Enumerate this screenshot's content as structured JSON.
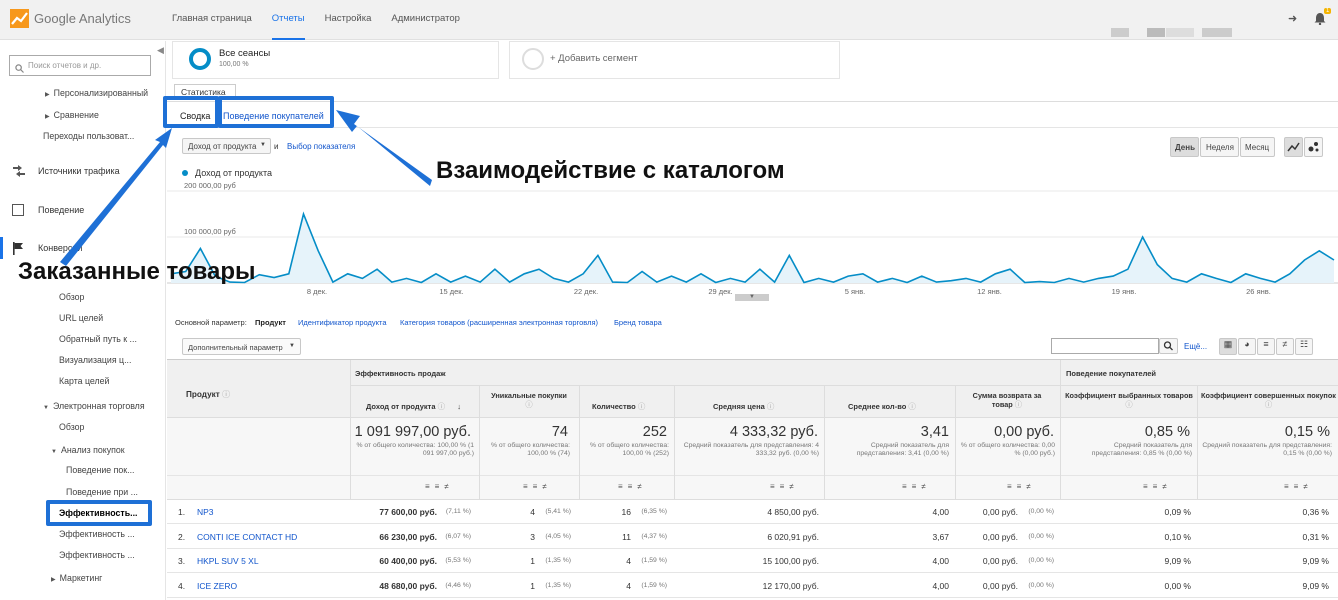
{
  "app": {
    "name": "Google Analytics"
  },
  "topnav": [
    {
      "label": "Главная страница",
      "active": false
    },
    {
      "label": "Отчеты",
      "active": true
    },
    {
      "label": "Настройка",
      "active": false
    },
    {
      "label": "Администратор",
      "active": false
    }
  ],
  "notifications_badge": "1",
  "sidebar": {
    "search_placeholder": "Поиск отчетов и др.",
    "items": [
      {
        "label": "Персонализированный",
        "caret": true
      },
      {
        "label": "Сравнение",
        "caret": true
      },
      {
        "label": "Переходы пользоват..."
      },
      {
        "label": "Источники трафика",
        "section": true
      },
      {
        "label": "Поведение",
        "section": true
      },
      {
        "label": "Конверсии",
        "section": true
      },
      {
        "label": "Обзор"
      },
      {
        "label": "URL целей"
      },
      {
        "label": "Обратный путь к ..."
      },
      {
        "label": "Визуализация ц..."
      },
      {
        "label": "Карта целей"
      },
      {
        "label": "Электронная торговля",
        "caret": true
      },
      {
        "label": "Обзор"
      },
      {
        "label": "Анализ покупок",
        "caret": true
      },
      {
        "label": "Поведение пок..."
      },
      {
        "label": "Поведение при ..."
      },
      {
        "label": "Эффективность...",
        "selected": true
      },
      {
        "label": "Эффективность ..."
      },
      {
        "label": "Эффективность ..."
      },
      {
        "label": "Маркетинг",
        "caret": true
      }
    ]
  },
  "segments": {
    "all_sessions": "Все сеансы",
    "all_sessions_pct": "100,00 %",
    "add_segment": "+ Добавить сегмент"
  },
  "tabs": {
    "stats": "Статистика",
    "summary": "Сводка",
    "behavior": "Поведение покупателей"
  },
  "chart_controls": {
    "metric_select": "Доход от продукта",
    "and": "и",
    "choose_metric": "Выбор показателя",
    "day": "День",
    "week": "Неделя",
    "month": "Месяц"
  },
  "chart_data": {
    "type": "area",
    "legend": "Доход от продукта",
    "ylim": [
      0,
      200000
    ],
    "yticks": [
      "200 000,00 руб",
      "100 000,00 руб"
    ],
    "xticks": [
      "8 дек.",
      "15 дек.",
      "22 дек.",
      "29 дек.",
      "5 янв.",
      "12 янв.",
      "19 янв.",
      "26 янв."
    ],
    "color": "#058dc7",
    "series": [
      {
        "values": [
          20000,
          25000,
          75000,
          15000,
          2000,
          1000,
          18000,
          12000,
          20000,
          150000,
          70000,
          2000,
          20000,
          10000,
          30000,
          2000,
          10000,
          1000,
          20000,
          2000,
          15000,
          2000,
          30000,
          2000,
          20000,
          30000,
          10000,
          2000,
          20000,
          60000,
          2000,
          1000,
          25000,
          2000,
          15000,
          2000,
          20000,
          1000,
          10000,
          2000,
          30000,
          2000,
          60000,
          1000,
          10000,
          2000,
          15000,
          20000,
          2000,
          10000,
          1000,
          15000,
          2000,
          5000,
          10000,
          2000,
          20000,
          30000,
          1000,
          3000,
          1000,
          10000,
          2000,
          10000,
          15000,
          30000,
          100000,
          40000,
          10000,
          2000,
          20000,
          10000,
          1000,
          20000,
          10000,
          2000,
          20000,
          50000,
          70000,
          50000
        ]
      }
    ]
  },
  "dimensions": {
    "label": "Основной параметр:",
    "active": "Продукт",
    "items": [
      "Идентификатор продукта",
      "Категория товаров (расширенная электронная торговля)",
      "Бренд товара"
    ],
    "secondary": "Дополнительный параметр",
    "more": "Ещё..."
  },
  "table": {
    "group_sales": "Эффективность продаж",
    "group_behavior": "Поведение покупателей",
    "col_product": "Продукт",
    "columns": [
      "Доход от продукта",
      "Уникальные покупки",
      "Количество",
      "Средняя цена",
      "Среднее кол-во",
      "Сумма возврата за товар",
      "Коэффициент выбранных товаров",
      "Коэффициент совершенных покупок"
    ],
    "totals": [
      {
        "value": "1 091 997,00 руб.",
        "note": "% от общего количества: 100,00 % (1 091 997,00 руб.)"
      },
      {
        "value": "74",
        "note": "% от общего количества: 100,00 % (74)"
      },
      {
        "value": "252",
        "note": "% от общего количества: 100,00 % (252)"
      },
      {
        "value": "4 333,32 руб.",
        "note": "Средний показатель для представления: 4 333,32 руб. (0,00 %)"
      },
      {
        "value": "3,41",
        "note": "Средний показатель для представления: 3,41 (0,00 %)"
      },
      {
        "value": "0,00 руб.",
        "note": "% от общего количества: 0,00 % (0,00 руб.)"
      },
      {
        "value": "0,85 %",
        "note": "Средний показатель для представления: 0,85 % (0,00 %)"
      },
      {
        "value": "0,15 %",
        "note": "Средний показатель для представления: 0,15 % (0,00 %)"
      }
    ],
    "rows": [
      {
        "n": "1.",
        "product": "NP3",
        "revenue": "77 600,00 руб.",
        "revenue_pct": "(7,11 %)",
        "unique": "4",
        "unique_pct": "(5,41 %)",
        "qty": "16",
        "qty_pct": "(6,35 %)",
        "avg_price": "4 850,00 руб.",
        "avg_qty": "4,00",
        "refund": "0,00 руб.",
        "refund_pct": "(0,00 %)",
        "cart_rate": "0,09 %",
        "buy_rate": "0,36 %"
      },
      {
        "n": "2.",
        "product": "CONTI ICE CONTACT HD",
        "revenue": "66 230,00 руб.",
        "revenue_pct": "(6,07 %)",
        "unique": "3",
        "unique_pct": "(4,05 %)",
        "qty": "11",
        "qty_pct": "(4,37 %)",
        "avg_price": "6 020,91 руб.",
        "avg_qty": "3,67",
        "refund": "0,00 руб.",
        "refund_pct": "(0,00 %)",
        "cart_rate": "0,10 %",
        "buy_rate": "0,31 %"
      },
      {
        "n": "3.",
        "product": "HKPL SUV 5 XL",
        "revenue": "60 400,00 руб.",
        "revenue_pct": "(5,53 %)",
        "unique": "1",
        "unique_pct": "(1,35 %)",
        "qty": "4",
        "qty_pct": "(1,59 %)",
        "avg_price": "15 100,00 руб.",
        "avg_qty": "4,00",
        "refund": "0,00 руб.",
        "refund_pct": "(0,00 %)",
        "cart_rate": "9,09 %",
        "buy_rate": "9,09 %"
      },
      {
        "n": "4.",
        "product": "ICE ZERO",
        "revenue": "48 680,00 руб.",
        "revenue_pct": "(4,46 %)",
        "unique": "1",
        "unique_pct": "(1,35 %)",
        "qty": "4",
        "qty_pct": "(1,59 %)",
        "avg_price": "12 170,00 руб.",
        "avg_qty": "4,00",
        "refund": "0,00 руб.",
        "refund_pct": "(0,00 %)",
        "cart_rate": "0,00 %",
        "buy_rate": "9,09 %"
      }
    ]
  },
  "annotations": {
    "catalog": "Взаимодействие с каталогом",
    "ordered": "Заказанные товары",
    "color": "#1e70d6"
  }
}
